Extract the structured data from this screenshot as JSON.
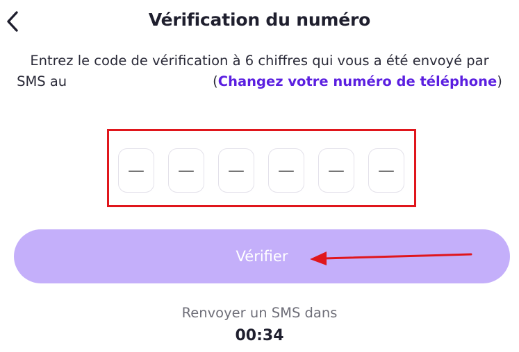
{
  "header": {
    "title": "Vérification du numéro",
    "back_icon": "chevron-left-icon"
  },
  "instructions": {
    "text_before": "Entrez le code de vérification à 6 chiffres qui vous a été envoyé par SMS au",
    "paren_open": "(",
    "change_link": "Changez votre numéro de téléphone",
    "paren_close": ")",
    "link_color": "#5b1fe0"
  },
  "code": {
    "digits": [
      {
        "placeholder": "—"
      },
      {
        "placeholder": "—"
      },
      {
        "placeholder": "—"
      },
      {
        "placeholder": "—"
      },
      {
        "placeholder": "—"
      },
      {
        "placeholder": "—"
      }
    ],
    "highlight_color": "#e0161c"
  },
  "verify_button": {
    "label": "Vérifier",
    "color": "#c4affa",
    "state": "disabled"
  },
  "resend": {
    "label": "Renvoyer un SMS dans",
    "countdown": "00:34"
  }
}
